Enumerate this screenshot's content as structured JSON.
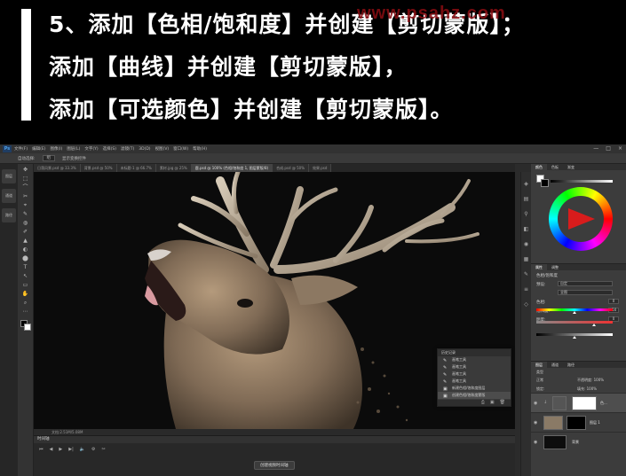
{
  "title": {
    "line1": "5、添加【色相/饱和度】并创建【剪切蒙版】；",
    "line2": "添加【曲线】并创建【剪切蒙版】，",
    "line3": "添加【可选颜色】并创建【剪切蒙版】。",
    "watermark": "www.psahz.com",
    "watermark_color": "#8a0d12"
  },
  "ps": {
    "logo": "Ps",
    "menu": [
      "文件(F)",
      "编辑(E)",
      "图像(I)",
      "图层(L)",
      "文字(Y)",
      "选择(S)",
      "滤镜(T)",
      "3D(D)",
      "视图(V)",
      "窗口(W)",
      "帮助(H)"
    ],
    "window_controls": [
      "—",
      "□",
      "×"
    ],
    "options": {
      "tool_label": "自动选择:",
      "select_value": "组",
      "transform_label": "显示变换控件"
    },
    "doc_tabs": [
      {
        "label": "日落风景.psd @ 33.3%",
        "active": false
      },
      {
        "label": "背景.psd @ 50%",
        "active": false
      },
      {
        "label": "未标题-1 @ 66.7%",
        "active": false
      },
      {
        "label": "素材.jpg @ 25%",
        "active": false
      },
      {
        "label": "鹿.psd @ 100% (色相/饱和度 1, 图层蒙版/8)",
        "active": true
      },
      {
        "label": "合成.psd @ 50%",
        "active": false
      },
      {
        "label": "效果.psd",
        "active": false
      }
    ],
    "rail": [
      "图层",
      "通道",
      "路径"
    ],
    "tools": [
      "✥",
      "⬚",
      "⌒",
      "✂",
      "⌖",
      "✎",
      "◍",
      "✐",
      "▲",
      "◐",
      "⬤",
      "T",
      "↖",
      "▭",
      "✋",
      "⌕",
      "⋯"
    ],
    "canvas_status": "文档:2.51M/5.08M",
    "timeline": {
      "title": "时间轴",
      "controls": [
        "⏮",
        "◀",
        "▶",
        "▶|",
        "🔈",
        "⚙",
        "✂"
      ],
      "create_button": "创建视频时间轴"
    },
    "history": {
      "title": "历史记录",
      "items": [
        {
          "label": "画笔工具",
          "active": false
        },
        {
          "label": "画笔工具",
          "active": false
        },
        {
          "label": "画笔工具",
          "active": false
        },
        {
          "label": "画笔工具",
          "active": false
        },
        {
          "label": "新建色相/饱和度图层",
          "active": false
        },
        {
          "label": "创建色相/饱和度蒙版",
          "active": true
        }
      ],
      "footer_icons": [
        "⎙",
        "▣",
        "🗑"
      ]
    },
    "right_icons": [
      "◈",
      "▤",
      "⚲",
      "◧",
      "◉",
      "▦",
      "✎",
      "≡",
      "◇"
    ],
    "color_panel": {
      "tabs": [
        {
          "label": "颜色",
          "active": true
        },
        {
          "label": "色板",
          "active": false
        },
        {
          "label": "渐变",
          "active": false
        }
      ]
    },
    "properties": {
      "tabs": [
        {
          "label": "属性",
          "active": true
        },
        {
          "label": "调整",
          "active": false
        }
      ],
      "header": "色相/饱和度",
      "preset_label": "预设:",
      "preset_value": "自定",
      "channel_value": "全图",
      "hue_label": "色相:",
      "hue_value": "0",
      "hue_level": 0.5,
      "sat_label": "饱和度:",
      "sat_value": "-50",
      "sat_level": 0.75,
      "light_label": "明度:",
      "light_value": "0",
      "light_level": 0.5
    },
    "layers": {
      "tabs": [
        {
          "label": "图层",
          "active": true
        },
        {
          "label": "通道",
          "active": false
        },
        {
          "label": "路径",
          "active": false
        }
      ],
      "filter_label": "类型",
      "blend_mode": "正常",
      "opacity_label": "不透明度: 100%",
      "lock_label": "锁定:",
      "fill_label": "填充: 100%",
      "items": [
        {
          "name": "色...",
          "selected": true
        },
        {
          "name": "图层 1",
          "selected": false
        },
        {
          "name": "背景",
          "selected": false
        }
      ]
    }
  }
}
